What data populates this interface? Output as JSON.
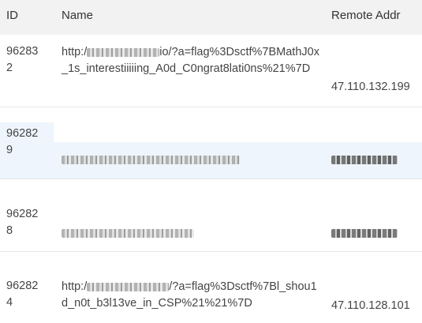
{
  "header": {
    "id": "ID",
    "name": "Name",
    "remote_addr": "Remote Addr"
  },
  "rows": [
    {
      "id_line1": "96283",
      "id_line2": "2",
      "name_prefix": "http:/",
      "name_rest": "io/?a=flag%3Dsctf%7BMathJ0x_1s_interestiiiiing_A0d_C0ngrat8lati0ns%21%7D",
      "remote_addr": "47.110.132.199"
    },
    {
      "id_line1": "96282",
      "id_line2": "9",
      "name_prefix": "",
      "name_rest": "",
      "remote_addr": ""
    },
    {
      "id_line1": "96282",
      "id_line2": "8",
      "name_prefix": "",
      "name_rest": "",
      "remote_addr": ""
    },
    {
      "id_line1": "96282",
      "id_line2": "4",
      "name_prefix": "http:/",
      "name_rest": "/?a=flag%3Dsctf%7Bl_shou1d_n0t_b3l13ve_in_CSP%21%21%7D",
      "remote_addr": "47.110.128.101"
    }
  ]
}
